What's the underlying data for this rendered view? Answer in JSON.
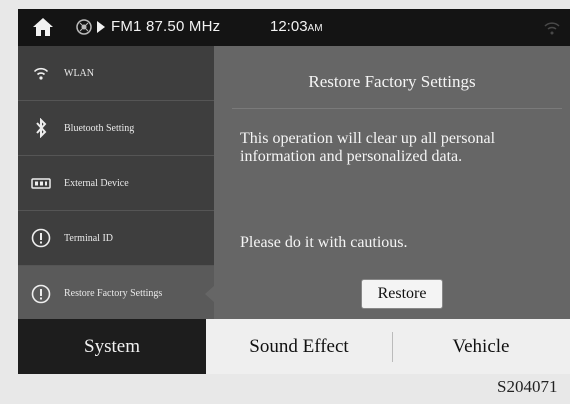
{
  "status_bar": {
    "frequency": "FM1 87.50 MHz",
    "time": "12:03",
    "ampm": "AM"
  },
  "sidebar": {
    "items": [
      {
        "label": "WLAN",
        "icon": "wifi-icon"
      },
      {
        "label": "Bluetooth Setting",
        "icon": "bluetooth-icon"
      },
      {
        "label": "External Device",
        "icon": "external-device-icon"
      },
      {
        "label": "Terminal ID",
        "icon": "info-circle-icon"
      },
      {
        "label": "Restore Factory Settings",
        "icon": "info-circle-icon",
        "active": true
      }
    ]
  },
  "content": {
    "title": "Restore Factory Settings",
    "message": "This operation will clear up all personal information and personalized data.",
    "caution": "Please do it with cautious.",
    "restore_label": "Restore"
  },
  "tabs": [
    {
      "label": "System",
      "active": true
    },
    {
      "label": "Sound Effect"
    },
    {
      "label": "Vehicle"
    }
  ],
  "figure_code": "S204071"
}
